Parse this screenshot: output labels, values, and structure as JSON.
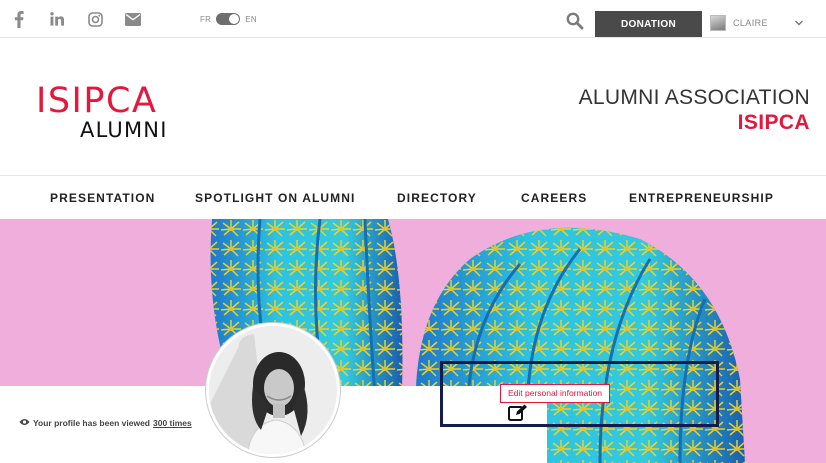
{
  "topbar": {
    "social": [
      {
        "name": "facebook",
        "icon": "facebook-icon"
      },
      {
        "name": "linkedin",
        "icon": "linkedin-icon"
      },
      {
        "name": "instagram",
        "icon": "instagram-icon"
      },
      {
        "name": "email",
        "icon": "envelope-icon"
      }
    ],
    "lang_left": "FR",
    "lang_right": "EN",
    "search_icon": "search-icon",
    "donation_label": "DONATION",
    "user_name": "CLAIRE",
    "user_menu_icon": "chevron-down-icon"
  },
  "header": {
    "logo_line1": "ISIPCA",
    "logo_line2": "ALUMNI",
    "assoc_line1": "ALUMNI ASSOCIATION",
    "assoc_line2": "ISIPCA"
  },
  "nav": {
    "items": [
      {
        "label": "PRESENTATION"
      },
      {
        "label": "SPOTLIGHT ON ALUMNI"
      },
      {
        "label": "DIRECTORY"
      },
      {
        "label": "CAREERS"
      },
      {
        "label": "ENTREPRENEURSHIP"
      }
    ]
  },
  "profile": {
    "views_prefix": "Your profile has been viewed",
    "views_count": "300 times",
    "edit_tooltip": "Edit personal information",
    "edit_icon": "edit-icon"
  },
  "colors": {
    "brand_red": "#e4173c",
    "donation_bg": "#4a4a4a",
    "banner_pink": "#f0aedd",
    "cactus_blue": "#22b8d8",
    "spine_yellow": "#f4d321",
    "highlight_navy": "#141b4d"
  }
}
